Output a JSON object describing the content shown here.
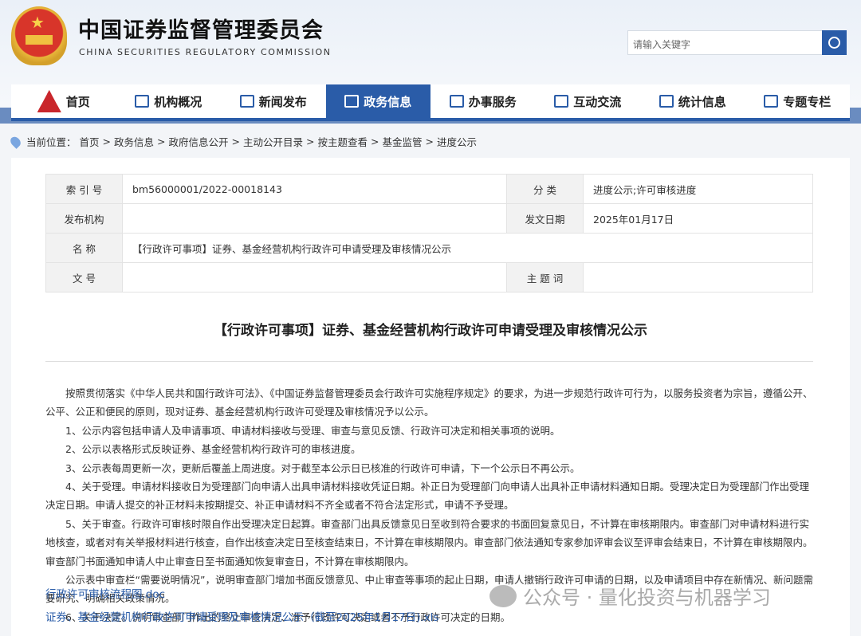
{
  "header": {
    "title_cn": "中国证券监督管理委员会",
    "title_en": "CHINA SECURITIES REGULATORY COMMISSION",
    "search_placeholder": "请输入关键字"
  },
  "nav": [
    {
      "label": "首页"
    },
    {
      "label": "机构概况"
    },
    {
      "label": "新闻发布"
    },
    {
      "label": "政务信息",
      "active": true
    },
    {
      "label": "办事服务"
    },
    {
      "label": "互动交流"
    },
    {
      "label": "统计信息"
    },
    {
      "label": "专题专栏"
    }
  ],
  "breadcrumb": {
    "prefix": "当前位置：",
    "items": [
      "首页",
      "政务信息",
      "政府信息公开",
      "主动公开目录",
      "按主题查看",
      "基金监管",
      "进度公示"
    ]
  },
  "meta": {
    "index_label": "索 引 号",
    "index_value": "bm56000001/2022-00018143",
    "category_label": "分 类",
    "category_value": "进度公示;许可审核进度",
    "publisher_label": "发布机构",
    "publisher_value": "",
    "date_label": "发文日期",
    "date_value": "2025年01月17日",
    "name_label": "名 称",
    "name_value": "【行政许可事项】证券、基金经营机构行政许可申请受理及审核情况公示",
    "docno_label": "文 号",
    "docno_value": "",
    "topic_label": "主 题 词",
    "topic_value": ""
  },
  "doc_title": "【行政许可事项】证券、基金经营机构行政许可申请受理及审核情况公示",
  "paragraphs": [
    "按照贯彻落实《中华人民共和国行政许可法》、《中国证券监督管理委员会行政许可实施程序规定》的要求，为进一步规范行政许可行为，以服务投资者为宗旨，遵循公开、公平、公正和便民的原则，现对证券、基金经营机构行政许可受理及审核情况予以公示。",
    "1、公示内容包括申请人及申请事项、申请材料接收与受理、审查与意见反馈、行政许可决定和相关事项的说明。",
    "2、公示以表格形式反映证券、基金经营机构行政许可的审核进度。",
    "3、公示表每周更新一次，更新后覆盖上周进度。对于截至本公示日已核准的行政许可申请，下一个公示日不再公示。",
    "4、关于受理。申请材料接收日为受理部门向申请人出具申请材料接收凭证日期。补正日为受理部门向申请人出具补正申请材料通知日期。受理决定日为受理部门作出受理决定日期。申请人提交的补正材料未按期提交、补正申请材料不齐全或者不符合法定形式，申请不予受理。",
    "5、关于审查。行政许可审核时限自作出受理决定日起算。审查部门出具反馈意见日至收到符合要求的书面回复意见日，不计算在审核期限内。审查部门对申请材料进行实地核查，或者对有关举报材料进行核查，自作出核查决定日至核查结束日，不计算在审核期限内。审查部门依法通知专家参加评审会议至评审会结束日，不计算在审核期限内。审查部门书面通知申请人中止审查日至书面通知恢复审查日，不计算在审核期限内。",
    "公示表中审查栏“需要说明情况”，说明审查部门增加书面反馈意见、中止审查等事项的起止日期，申请人撤销行政许可申请的日期，以及申请项目中存在新情况、新问题需要研究、明确相关政策情况。",
    "6、关于决定。说明审查部门作出的终止审查决定、准予行政许可决定或者不予行政许可决定的日期。"
  ],
  "attachments": [
    "行政许可审核流程图.doc",
    "证券、基金经营机构行政许可申请受理及审核情况公示（截至2025年1月17日).xls"
  ],
  "watermark": "公众号 · 量化投资与机器学习"
}
